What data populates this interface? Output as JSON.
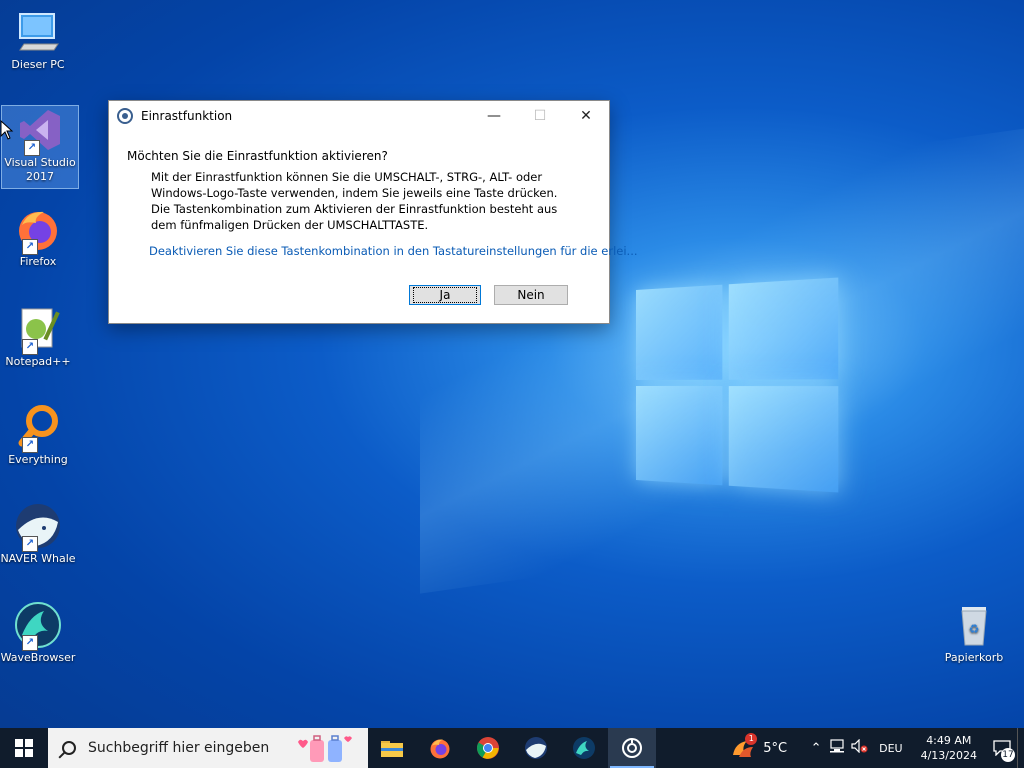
{
  "desktop": {
    "icons": [
      {
        "label": "Dieser PC"
      },
      {
        "label": "Visual Studio 2017"
      },
      {
        "label": "Firefox"
      },
      {
        "label": "Notepad++"
      },
      {
        "label": "Everything"
      },
      {
        "label": "NAVER Whale"
      },
      {
        "label": "WaveBrowser"
      },
      {
        "label": "Papierkorb"
      }
    ]
  },
  "dialog": {
    "title": "Einrastfunktion",
    "heading": "Möchten Sie die Einrastfunktion aktivieren?",
    "body": "Mit der Einrastfunktion können Sie die UMSCHALT-, STRG-, ALT- oder Windows-Logo-Taste verwenden, indem Sie jeweils eine Taste drücken. Die Tastenkombination zum Aktivieren der Einrastfunktion besteht aus dem fünfmaligen Drücken der UMSCHALTTASTE.",
    "link": "Deaktivieren Sie diese Tastenkombination in den Tastatureinstellungen für die erlei...",
    "yes_label": "Ja",
    "no_label": "Nein",
    "minimize": "—",
    "maximize": "☐",
    "close": "✕"
  },
  "taskbar": {
    "search_placeholder": "Suchbegriff hier eingeben",
    "weather": "5°C",
    "weather_badge": "1",
    "language": "DEU",
    "time": "4:49 AM",
    "date": "4/13/2024",
    "notifications": "17"
  }
}
